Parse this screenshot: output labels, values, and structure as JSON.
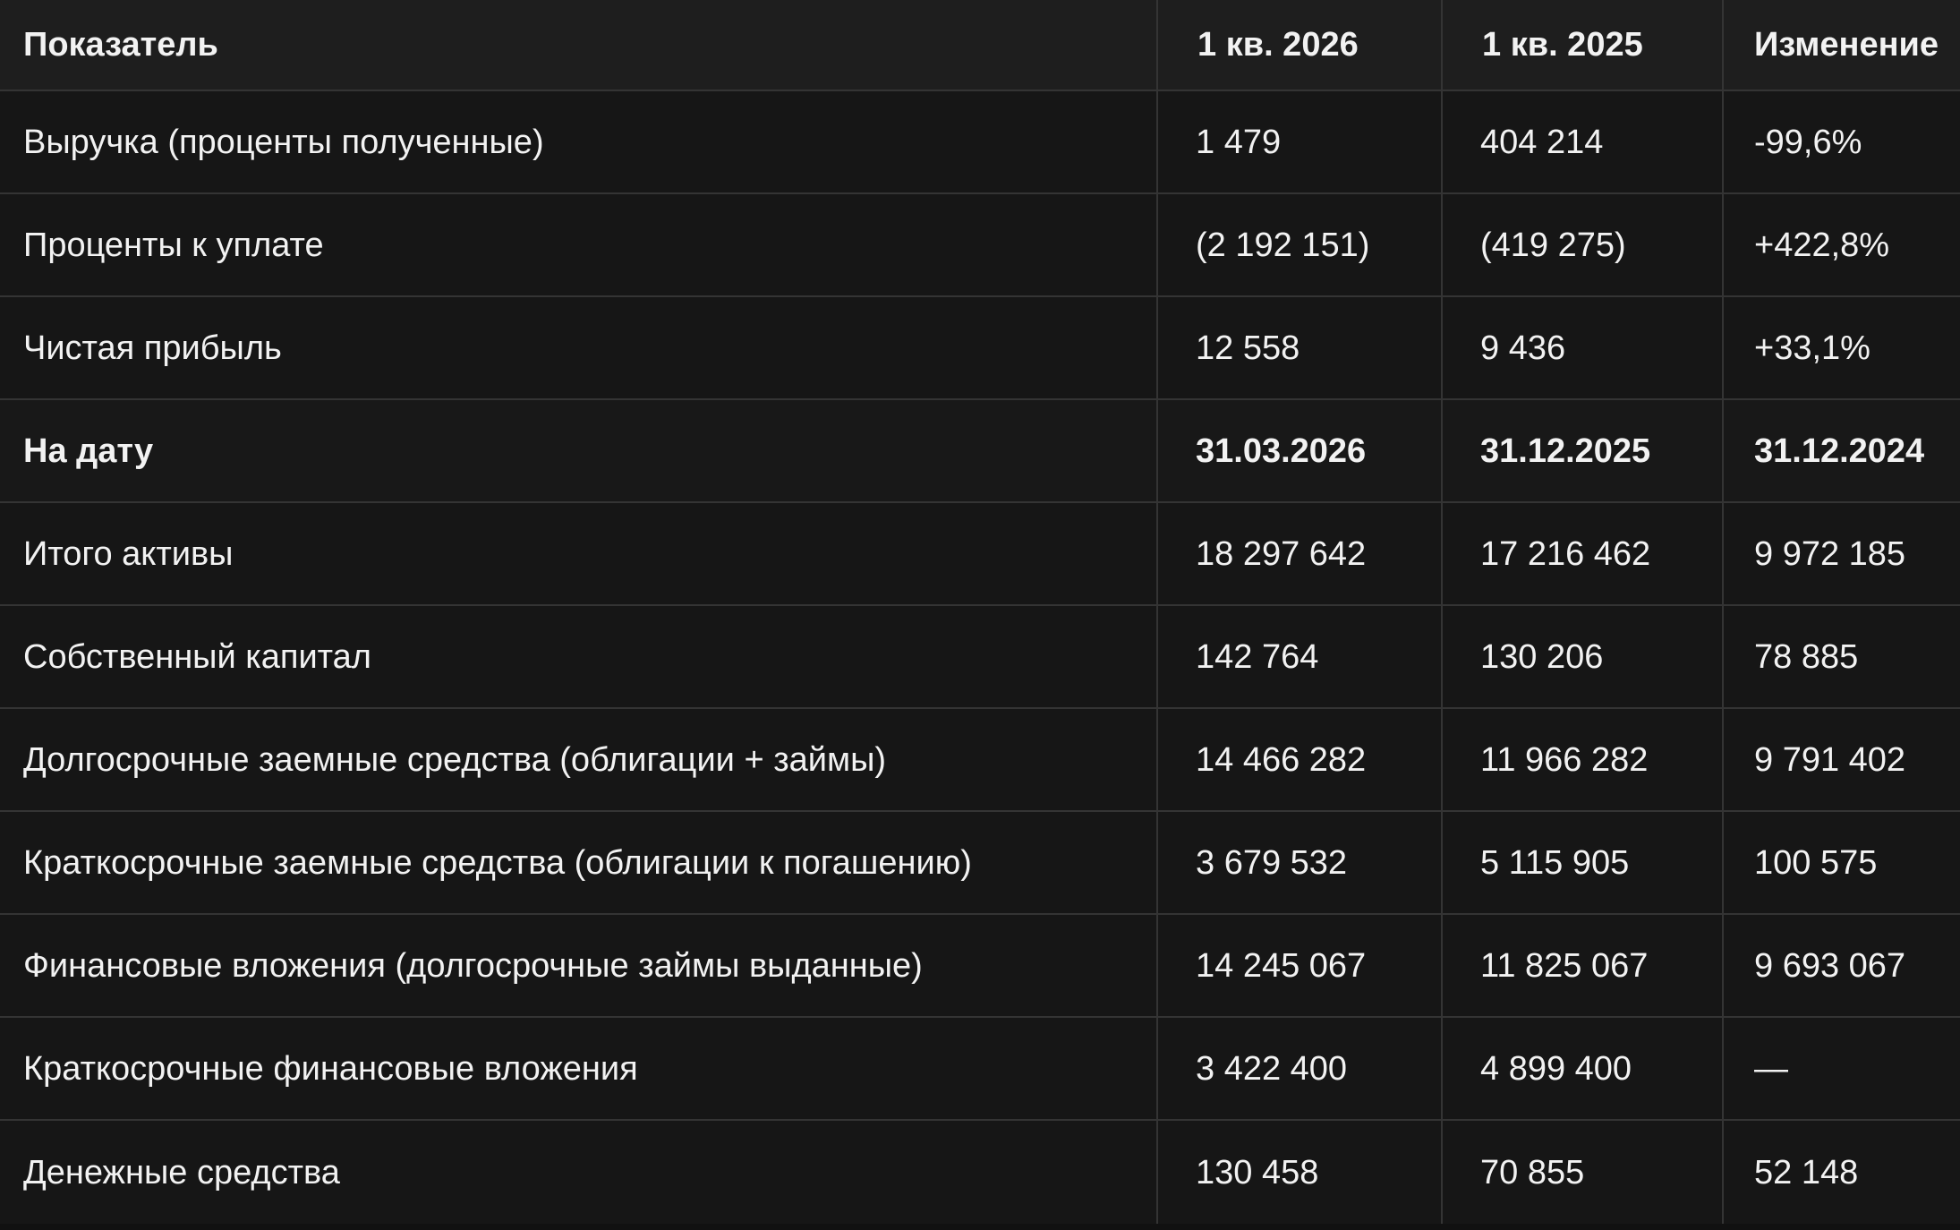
{
  "table": {
    "columns": [
      "Показатель",
      "1 кв. 2026",
      "1 кв. 2025",
      "Изменение"
    ],
    "rows": [
      [
        "Выручка (проценты полученные)",
        "1 479",
        "404 214",
        "-99,6%"
      ],
      [
        "Проценты к уплате",
        "(2 192 151)",
        "(419 275)",
        "+422,8%"
      ],
      [
        "Чистая прибыль",
        "12 558",
        "9 436",
        "+33,1%"
      ],
      [
        "На дату",
        "31.03.2026",
        "31.12.2025",
        "31.12.2024"
      ],
      [
        "Итого активы",
        "18 297 642",
        "17 216 462",
        "9 972 185"
      ],
      [
        "Собственный капитал",
        "142 764",
        "130 206",
        "78 885"
      ],
      [
        "Долгосрочные заемные средства (облигации + займы)",
        "14 466 282",
        "11 966 282",
        "9 791 402"
      ],
      [
        "Краткосрочные заемные средства (облигации к погашению)",
        "3 679 532",
        "5 115 905",
        "100 575"
      ],
      [
        "Финансовые вложения (долгосрочные займы выданные)",
        "14 245 067",
        "11 825 067",
        "9 693 067"
      ],
      [
        "Краткосрочные финансовые вложения",
        "3 422 400",
        "4 899 400",
        "—"
      ],
      [
        "Денежные средства",
        "130 458",
        "70 855",
        "52 148"
      ]
    ]
  },
  "colors": {
    "background": "#111111",
    "header_background": "#1e1e1e",
    "row_background": "#161616",
    "grid_lines": "#343434",
    "text": "#f2f2f2"
  }
}
